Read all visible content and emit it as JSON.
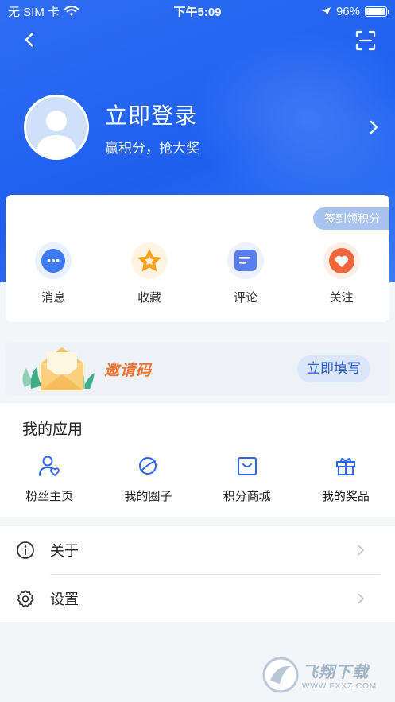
{
  "status_bar": {
    "carrier": "无 SIM 卡",
    "time": "下午5:09",
    "battery": "96%",
    "battery_level": 0.96
  },
  "header": {
    "back_icon": "chevron-left-icon",
    "scan_icon": "scan-icon"
  },
  "profile": {
    "title": "立即登录",
    "subtitle": "赢积分，抢大奖"
  },
  "card": {
    "sign_badge": "签到领积分",
    "items": [
      {
        "label": "消息",
        "icon": "message-icon",
        "color": "#3d79f0"
      },
      {
        "label": "收藏",
        "icon": "star-icon",
        "color": "#f8a21b"
      },
      {
        "label": "评论",
        "icon": "comment-icon",
        "color": "#5a7df0"
      },
      {
        "label": "关注",
        "icon": "heart-icon",
        "color": "#f2663c"
      }
    ]
  },
  "invite": {
    "text": "邀请码",
    "button": "立即填写"
  },
  "apps": {
    "title": "我的应用",
    "items": [
      {
        "label": "粉丝主页",
        "icon": "fans-icon"
      },
      {
        "label": "我的圈子",
        "icon": "planet-icon"
      },
      {
        "label": "积分商城",
        "icon": "shop-icon"
      },
      {
        "label": "我的奖品",
        "icon": "gift-icon"
      }
    ]
  },
  "menu": {
    "items": [
      {
        "label": "关于",
        "icon": "info-icon"
      },
      {
        "label": "设置",
        "icon": "settings-icon"
      }
    ]
  },
  "watermark": {
    "cn": "飞翔下载",
    "url": "WWW.FXXZ.COM"
  },
  "colors": {
    "brand_blue": "#2a64f0",
    "accent_orange": "#f07433"
  }
}
